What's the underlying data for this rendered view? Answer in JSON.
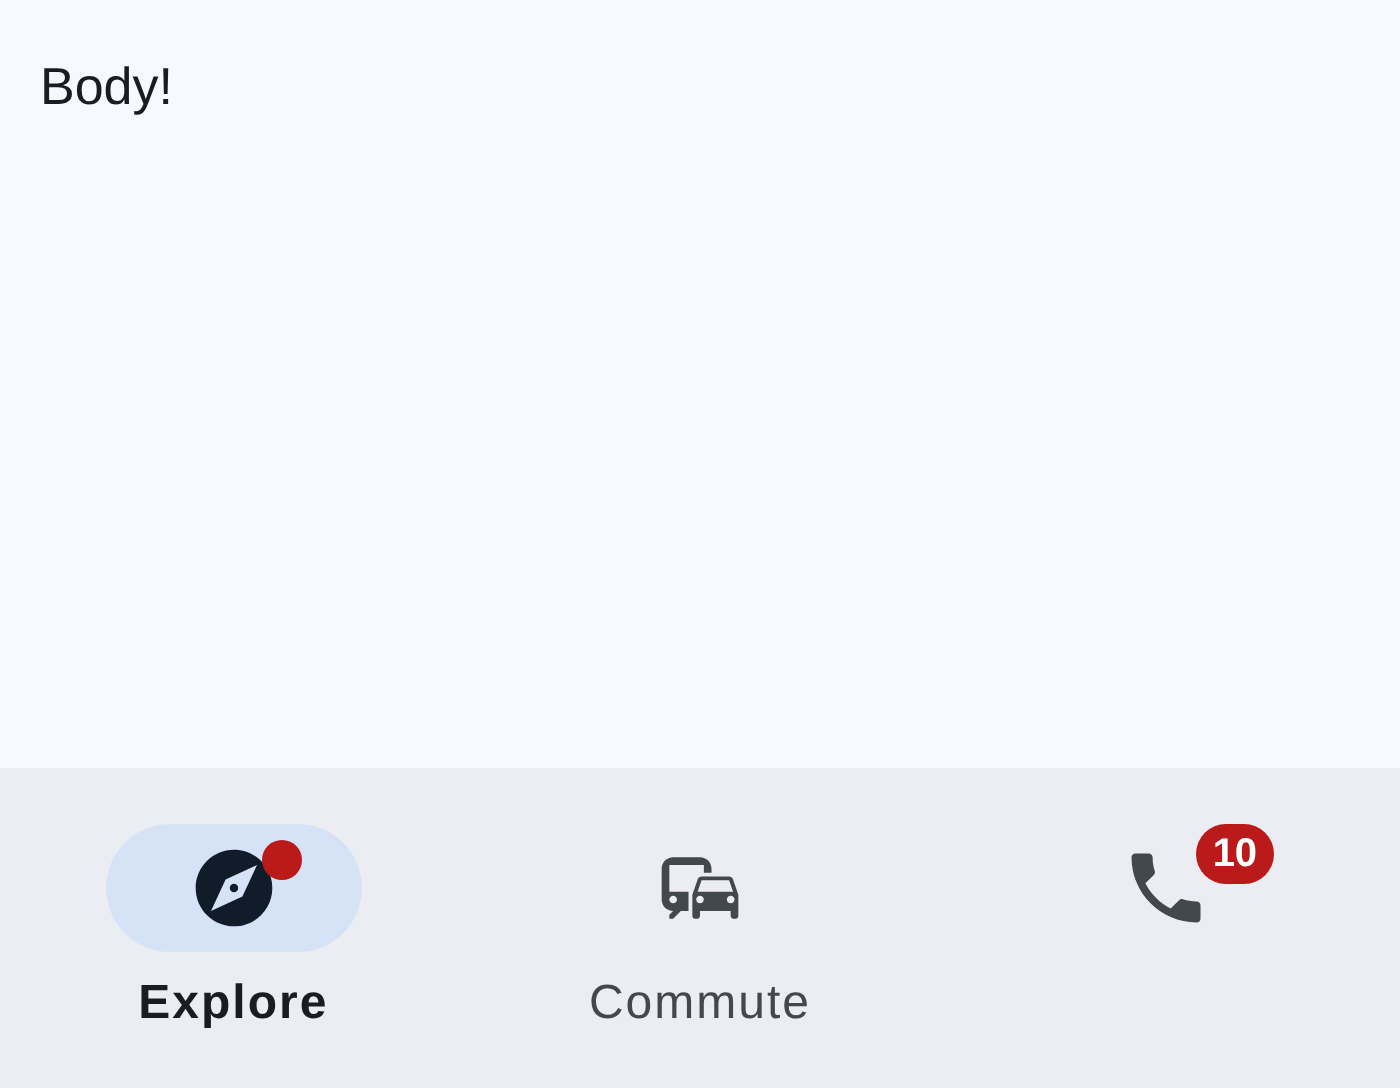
{
  "body": {
    "text": "Body!"
  },
  "navigation_bar": {
    "items": [
      {
        "label": "Explore",
        "selected": true,
        "badge": {
          "kind": "dot"
        }
      },
      {
        "label": "Commute",
        "selected": false
      },
      {
        "selected": false,
        "badge": {
          "kind": "count",
          "text": "10"
        }
      }
    ]
  }
}
